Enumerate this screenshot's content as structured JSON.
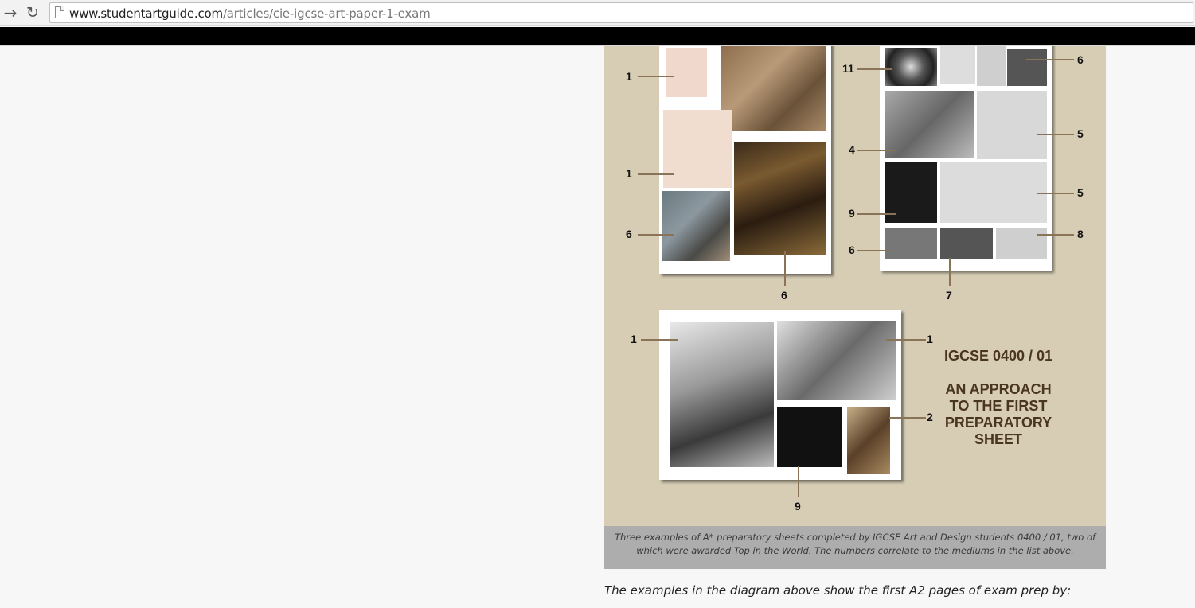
{
  "browser": {
    "url_domain": "www.studentartguide.com",
    "url_path": "/articles/cie-igcse-art-paper-1-exam",
    "back_icon": "back-arrow-icon",
    "reload_icon": "reload-icon"
  },
  "figure": {
    "title_line1": "IGCSE 0400 / 01",
    "title_line2": "AN APPROACH",
    "title_line3": "TO THE FIRST",
    "title_line4": "PREPARATORY",
    "title_line5": "SHEET",
    "labels": {
      "s1_a": "1",
      "s1_b": "1",
      "s1_c": "6",
      "s1_d": "6",
      "s2_a": "11",
      "s2_b": "6",
      "s2_c": "4",
      "s2_d": "5",
      "s2_e": "5",
      "s2_f": "9",
      "s2_g": "8",
      "s2_h": "6",
      "s2_i": "7",
      "s3_a": "1",
      "s3_b": "1",
      "s3_c": "2",
      "s3_d": "9"
    }
  },
  "caption": "Three examples of A* preparatory sheets completed by IGCSE Art and Design students 0400 / 01, two of which were awarded Top in the World. The numbers correlate to the mediums in the list above.",
  "body_text": "The examples in the diagram above show the first A2 pages of exam prep by:"
}
